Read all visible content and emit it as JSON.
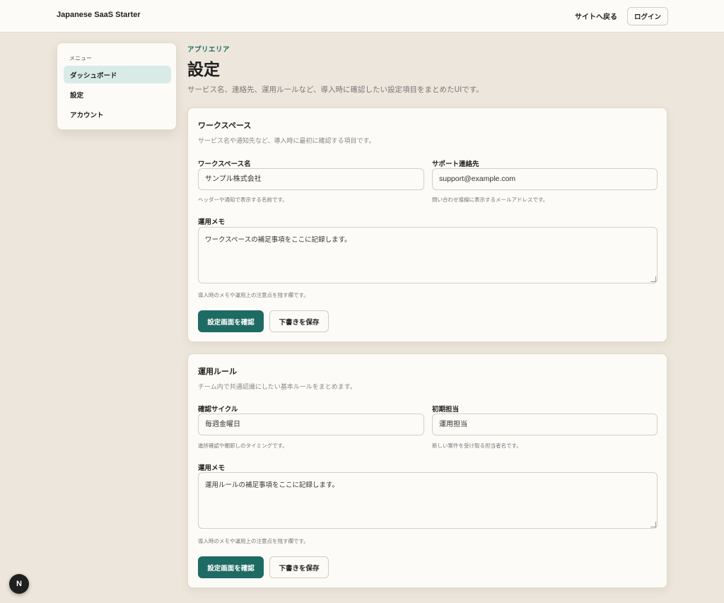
{
  "header": {
    "brand": "Japanese SaaS Starter",
    "back_link": "サイトへ戻る",
    "login_label": "ログイン"
  },
  "sidebar": {
    "heading": "メニュー",
    "items": [
      {
        "label": "ダッシュボード",
        "active": true
      },
      {
        "label": "設定",
        "active": false
      },
      {
        "label": "アカウント",
        "active": false
      }
    ]
  },
  "main": {
    "eyebrow": "アプリエリア",
    "title": "設定",
    "description": "サービス名、連絡先、運用ルールなど、導入時に確認したい設定項目をまとめたUIです。"
  },
  "workspace_card": {
    "title": "ワークスペース",
    "description": "サービス名や通知先など、導入時に最初に確認する項目です。",
    "name_label": "ワークスペース名",
    "name_value": "サンプル株式会社",
    "name_hint": "ヘッダーや通知で表示する名前です。",
    "contact_label": "サポート連絡先",
    "contact_value": "support@example.com",
    "contact_hint": "問い合わせ導線に表示するメールアドレスです。",
    "memo_label": "運用メモ",
    "memo_value": "ワークスペースの補足事項をここに記録します。",
    "memo_hint": "導入時のメモや運用上の注意点を残す欄です。",
    "confirm_label": "設定画面を確認",
    "save_label": "下書きを保存"
  },
  "rules_card": {
    "title": "運用ルール",
    "description": "チーム内で共通認識にしたい基本ルールをまとめます。",
    "cycle_label": "確認サイクル",
    "cycle_value": "毎週金曜日",
    "cycle_hint": "進捗確認や棚卸しのタイミングです。",
    "owner_label": "初期担当",
    "owner_value": "運用担当",
    "owner_hint": "新しい案件を受け取る担当者名です。",
    "memo_label": "運用メモ",
    "memo_value": "運用ルールの補足事項をここに記録します。",
    "memo_hint": "導入時のメモや運用上の注意点を残す欄です。",
    "confirm_label": "設定画面を確認",
    "save_label": "下書きを保存"
  },
  "badge": {
    "letter": "N"
  },
  "colors": {
    "background": "#ede6dc",
    "surface": "#fcfbf7",
    "accent": "#1e6b63",
    "active_nav": "#d9ebe7"
  }
}
